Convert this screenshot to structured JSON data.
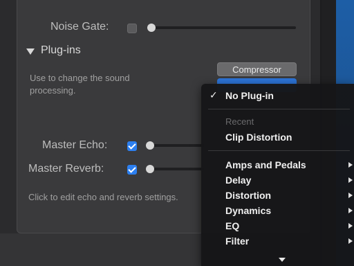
{
  "effects": {
    "noise_gate_label": "Noise Gate:",
    "noise_gate_checked": false,
    "master_echo_label": "Master Echo:",
    "master_echo_checked": true,
    "master_reverb_label": "Master Reverb:",
    "master_reverb_checked": true,
    "echo_reverb_help": "Click to edit echo and reverb settings."
  },
  "plugins": {
    "section_title": "Plug-ins",
    "description": "Use to change the sound processing.",
    "slot1_label": "Compressor",
    "slot2_label": ""
  },
  "menu": {
    "selected_item": "No Plug-in",
    "recent_heading": "Recent",
    "recent_items": [
      "Clip Distortion"
    ],
    "categories": [
      "Amps and Pedals",
      "Delay",
      "Distortion",
      "Dynamics",
      "EQ",
      "Filter"
    ]
  },
  "colors": {
    "accent": "#2c7ff0",
    "panel_bg": "#3a3a3c",
    "menu_bg": "#161618"
  }
}
